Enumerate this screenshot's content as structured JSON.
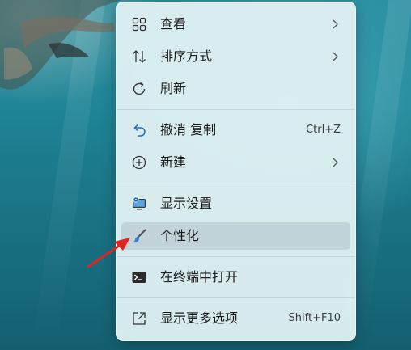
{
  "menu": {
    "items": [
      {
        "label": "查看",
        "icon": "grid-icon",
        "has_submenu": true
      },
      {
        "label": "排序方式",
        "icon": "sort-arrows-icon",
        "has_submenu": true
      },
      {
        "label": "刷新",
        "icon": "refresh-icon",
        "has_submenu": false
      },
      {
        "label": "撤消 复制",
        "icon": "undo-icon",
        "shortcut": "Ctrl+Z",
        "has_submenu": false
      },
      {
        "label": "新建",
        "icon": "new-plus-icon",
        "has_submenu": true
      },
      {
        "label": "显示设置",
        "icon": "display-settings-icon",
        "has_submenu": false
      },
      {
        "label": "个性化",
        "icon": "paintbrush-icon",
        "has_submenu": false,
        "highlighted": true
      },
      {
        "label": "在终端中打开",
        "icon": "terminal-icon",
        "has_submenu": false
      },
      {
        "label": "显示更多选项",
        "icon": "more-options-icon",
        "shortcut": "Shift+F10",
        "has_submenu": false
      }
    ]
  },
  "colors": {
    "menu_background": "#e0f0f3",
    "highlight": "#bed0d6",
    "accent_blue": "#1f6fc5",
    "annotation_arrow": "#e0241f"
  }
}
